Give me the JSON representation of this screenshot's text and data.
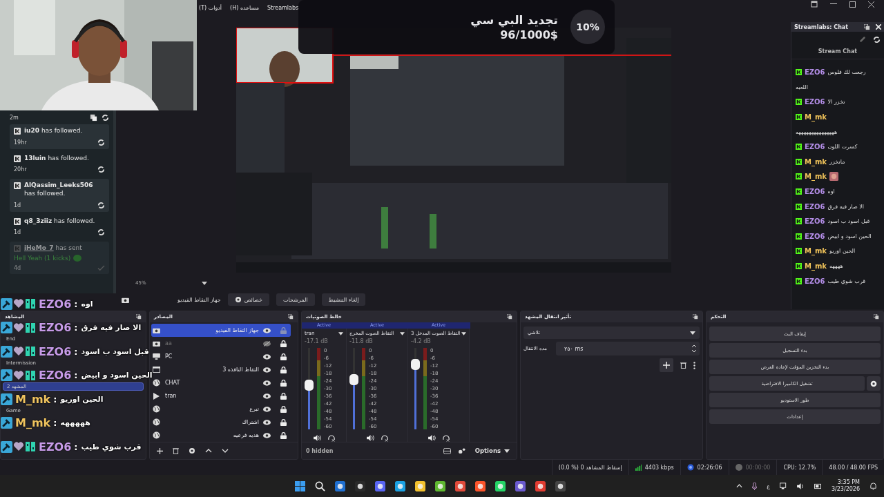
{
  "menu": [
    {
      "label": "Streamlabs"
    },
    {
      "label": "مساعده (H)"
    },
    {
      "label": "أدوات (T)"
    }
  ],
  "goal": {
    "title": "تجديد البي سي",
    "amount": "96/1000$",
    "percent": "10%"
  },
  "events": {
    "first_time": "2m",
    "items": [
      {
        "kind": "follow",
        "user": "iu20",
        "action": "has followed.",
        "time": "19hr"
      },
      {
        "kind": "follow",
        "user": "13luin",
        "action": "has followed.",
        "time": "20hr"
      },
      {
        "kind": "follow",
        "user": "AlQassim_Leeks506",
        "action": "has followed.",
        "time": "1d"
      },
      {
        "kind": "follow",
        "user": "q8_3ziiz",
        "action": "has followed.",
        "time": "1d"
      },
      {
        "kind": "kick",
        "user": "iHeMo_7",
        "action": "has sent",
        "message": "Hell Yeah (1 kicks)",
        "time": "4d"
      }
    ]
  },
  "chat_dock": {
    "title": "Streamlabs: Chat",
    "heading": "Stream Chat",
    "messages": [
      {
        "kind": "message",
        "user": "EZO6",
        "color": "#b48ee8",
        "text": "رجعت لك فلوس"
      },
      {
        "kind": "continuation",
        "text": "اللعبه"
      },
      {
        "kind": "message",
        "user": "EZO6",
        "color": "#b48ee8",
        "text": "تخزر الا"
      },
      {
        "kind": "message",
        "user": "M_mk",
        "color": "#f0c35a"
      },
      {
        "kind": "continuation",
        "text": "هههههههههههههههه"
      },
      {
        "kind": "message",
        "user": "EZO6",
        "color": "#b48ee8",
        "text": "كسرت اللون"
      },
      {
        "kind": "message",
        "user": "M_mk",
        "color": "#f0c35a",
        "text": "ماتخزر"
      },
      {
        "kind": "message",
        "user": "M_mk",
        "color": "#f0c35a",
        "emote": true
      },
      {
        "kind": "message",
        "user": "EZO6",
        "color": "#b48ee8",
        "text": "اوه"
      },
      {
        "kind": "message",
        "user": "EZO6",
        "color": "#b48ee8",
        "text": "الا صار فيه فرق"
      },
      {
        "kind": "message",
        "user": "EZO6",
        "color": "#b48ee8",
        "text": "قبل اسود ب اسود"
      },
      {
        "kind": "message",
        "user": "EZO6",
        "color": "#b48ee8",
        "text": "الحين اسود و ابيض"
      },
      {
        "kind": "message",
        "user": "M_mk",
        "color": "#f0c35a",
        "text": "الحين اوريو"
      },
      {
        "kind": "message",
        "user": "M_mk",
        "color": "#f0c35a",
        "text": "ههههه"
      },
      {
        "kind": "message",
        "user": "EZO6",
        "color": "#b48ee8",
        "text": "قرب شوي طيب"
      }
    ]
  },
  "chat_overlay": [
    {
      "user": "EZO6",
      "color": "#c79be8",
      "separator": ":",
      "text": "اوه",
      "badges": true
    },
    {
      "user": "EZO6",
      "color": "#c79be8",
      "separator": ":",
      "text": "الا صار فيه فرق",
      "badges": true
    },
    {
      "user": "EZO6",
      "color": "#c79be8",
      "separator": ":",
      "text": "قبل اسود ب اسود",
      "badges": true
    },
    {
      "user": "EZO6",
      "color": "#c79be8",
      "separator": ":",
      "text": "الحين اسود و ابيض",
      "badges": true
    },
    {
      "user": "M_mk",
      "color": "#efc35e",
      "separator": ":",
      "text": "الحين اوريو"
    },
    {
      "user": "M_mk",
      "color": "#efc35e",
      "separator": ":",
      "text": "هههههه"
    },
    {
      "user": "EZO6",
      "color": "#c79be8",
      "separator": ":",
      "text": "قرب شوي طيب",
      "badges": true
    }
  ],
  "zoom": "45%",
  "toolbar": {
    "source_label": "جهاز التقاط الفيديو",
    "buttons": [
      {
        "kind": "plain",
        "label": "إلغاء التنشيط"
      },
      {
        "kind": "plain",
        "label": "المرشحات"
      },
      {
        "kind": "gear",
        "label": "خصائص"
      }
    ]
  },
  "scenes": {
    "title": "المشاهد",
    "items": [
      {
        "name": "End",
        "selected": false
      },
      {
        "name": "Intermission",
        "selected": false
      },
      {
        "name": "المشهد 2",
        "selected": true
      },
      {
        "name": "Game",
        "selected": false
      }
    ]
  },
  "sources": {
    "title": "المصادر",
    "items": [
      {
        "name": "جهاز التقاط الفيديو",
        "kind": "camera",
        "selected": true,
        "visible": true,
        "locked": false
      },
      {
        "name": "aa",
        "kind": "camera",
        "selected": false,
        "visible": false,
        "locked": true
      },
      {
        "name": "PC",
        "kind": "monitor",
        "selected": false,
        "visible": true,
        "locked": true
      },
      {
        "name": "التقاط النافذه 3",
        "kind": "window",
        "selected": false,
        "visible": true,
        "locked": true
      },
      {
        "name": "CHAT",
        "kind": "browser",
        "selected": false,
        "visible": true,
        "locked": true
      },
      {
        "name": "tran",
        "kind": "media",
        "selected": false,
        "visible": true,
        "locked": true
      },
      {
        "name": "تبرع",
        "kind": "browser",
        "selected": false,
        "visible": true,
        "locked": true
      },
      {
        "name": "اشتراك",
        "kind": "browser",
        "selected": false,
        "visible": true,
        "locked": true
      },
      {
        "name": "هديه فرعيه",
        "kind": "browser",
        "selected": false,
        "visible": true,
        "locked": true
      }
    ]
  },
  "mixer": {
    "title": "خالط الصوتيات",
    "hidden": "0 hidden",
    "options": "Options",
    "channels": [
      {
        "status": "Active",
        "name": "التقاط الصوت المدخل 3",
        "reading": "-4.2 dB",
        "level": 0.8,
        "scale": [
          "0",
          "-6",
          "-12",
          "-18",
          "-24",
          "-30",
          "-36",
          "-42",
          "-48",
          "-54",
          "-60"
        ]
      },
      {
        "status": "Active",
        "name": "التقاط الصوت المخرج",
        "reading": "-11.8 dB",
        "level": 0.61,
        "scale": [
          "0",
          "-6",
          "-12",
          "-18",
          "-24",
          "-30",
          "-36",
          "-42",
          "-48",
          "-54",
          "-60"
        ]
      },
      {
        "status": "Active",
        "name": "tran",
        "reading": "-17.1 dB",
        "level": 0.54,
        "scale": [
          "0",
          "-6",
          "-12",
          "-18",
          "-24",
          "-30",
          "-36",
          "-42",
          "-48",
          "-54",
          "-60"
        ]
      }
    ]
  },
  "transitions": {
    "title": "تأثير انتقال المشهد",
    "effect": "تلاشي",
    "duration_label": "مده الانتقال",
    "duration": "٢٥٠ ms"
  },
  "controls": {
    "title": "التحكم",
    "buttons": [
      {
        "label": "إيقاف البث",
        "settings": false
      },
      {
        "label": "بدء التسجيل",
        "settings": false
      },
      {
        "label": "بدء التخزين المؤقت لإعادة العرض",
        "settings": false
      },
      {
        "label": "تشغيل الكاميرا الافتراضية",
        "settings": true
      },
      {
        "label": "طور الاستوديو",
        "settings": false
      },
      {
        "label": "إعدادات",
        "settings": false
      }
    ]
  },
  "status_bar": {
    "dropped": "(0.0 %) إسقاط المشاهد 0",
    "bitrate": "4403 kbps",
    "stream_time": "02:26:06",
    "record_time": "00:00:00",
    "cpu": "CPU: 12.7%",
    "fps": "48.00 / 48.00 FPS"
  },
  "taskbar": {
    "language": "ع",
    "time": "3:35 PM",
    "date": "3/23/2026"
  }
}
